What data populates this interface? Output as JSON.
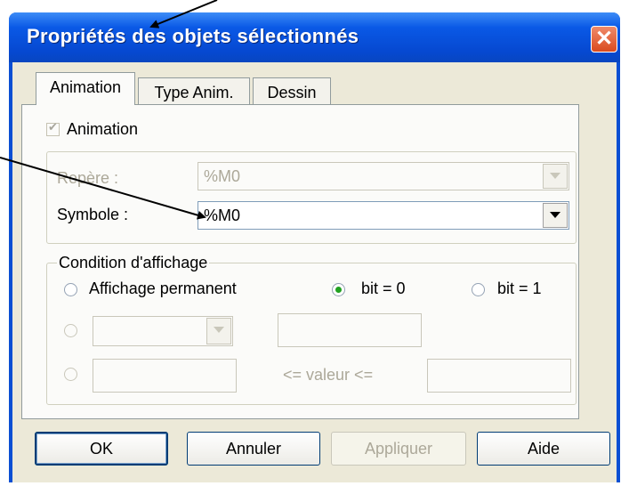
{
  "window": {
    "title": "Propriétés des objets sélectionnés",
    "close_glyph": "✕"
  },
  "tabs": [
    {
      "label": "Animation",
      "active": true
    },
    {
      "label": "Type Anim.",
      "active": false
    },
    {
      "label": "Dessin",
      "active": false
    }
  ],
  "animation": {
    "checkbox_label": "Animation",
    "checkbox_checked": true,
    "checkbox_enabled": false
  },
  "repere": {
    "label": "Repère :",
    "value": "%M0",
    "enabled": false
  },
  "symbole": {
    "label": "Symbole :",
    "value": "%M0",
    "enabled": true
  },
  "condition": {
    "legend": "Condition d'affichage",
    "options": [
      {
        "label": "Affichage  permanent",
        "selected": false
      },
      {
        "label": "bit = 0",
        "selected": true
      },
      {
        "label": "bit = 1",
        "selected": false
      }
    ],
    "range_label": "<= valeur <="
  },
  "buttons": {
    "ok": "OK",
    "cancel": "Annuler",
    "apply": "Appliquer",
    "help": "Aide"
  },
  "colors": {
    "title_bar": "#0a59e6",
    "close_button": "#d94a1e",
    "dialog_bg": "#ece9d8",
    "radio_selected": "#21a121"
  },
  "icons": {
    "close": "close-icon",
    "combo_arrow": "chevron-down-icon",
    "annotation": "arrow-annotation"
  }
}
